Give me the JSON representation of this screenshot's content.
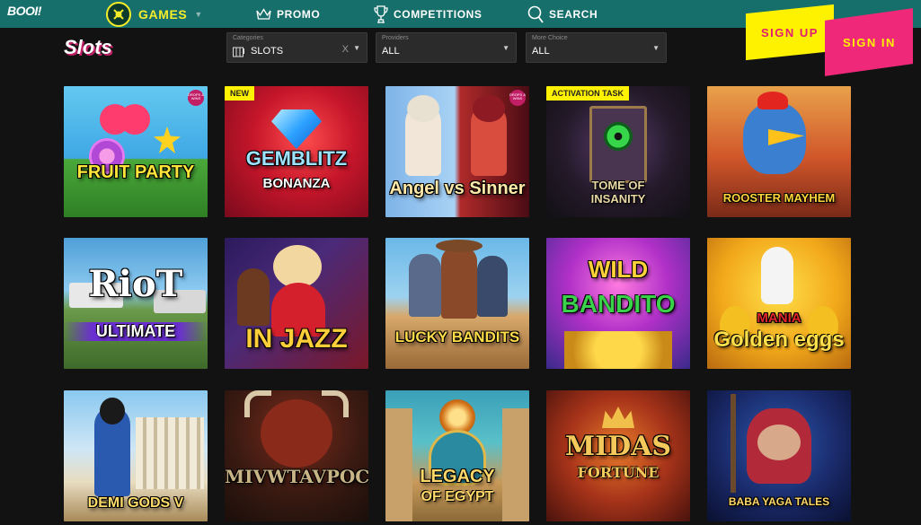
{
  "header": {
    "logo": "BOOI!",
    "nav": [
      {
        "label": "GAMES",
        "icon": "games-icon"
      },
      {
        "label": "PROMO",
        "icon": "crown-icon"
      },
      {
        "label": "COMPETITIONS",
        "icon": "trophy-icon"
      },
      {
        "label": "SEARCH",
        "icon": "search-icon"
      }
    ],
    "signup_label": "SIGN UP",
    "signin_label": "SIGN IN"
  },
  "page": {
    "title": "Slots"
  },
  "filters": {
    "categories": {
      "caption": "Categories",
      "value": "SLOTS",
      "clear": "X"
    },
    "providers": {
      "caption": "Providers",
      "value": "ALL"
    },
    "more_choice": {
      "caption": "More Choice",
      "value": "ALL"
    }
  },
  "games": [
    {
      "title": "FRUIT PARTY",
      "badge": "",
      "drops": "DROPS & WINS"
    },
    {
      "title": "GEMBLITZ",
      "subtitle": "BONANZA",
      "badge": "NEW"
    },
    {
      "title": "Angel vs Sinner",
      "badge": "",
      "drops": "DROPS & WINS"
    },
    {
      "title": "TOME OF",
      "subtitle": "INSANITY",
      "badge": "ACTIVATION TASK"
    },
    {
      "title": "ROOSTER MAYHEM",
      "badge": ""
    },
    {
      "title": "RioT",
      "subtitle": "ULTIMATE",
      "badge": ""
    },
    {
      "title": "IN JAZZ",
      "badge": ""
    },
    {
      "title": "LUCKY BANDITS",
      "badge": ""
    },
    {
      "title": "WILD",
      "subtitle": "BANDITO",
      "badge": ""
    },
    {
      "title": "MANIA",
      "subtitle": "Golden eggs",
      "badge": ""
    },
    {
      "title": "DEMI GODS V",
      "badge": ""
    },
    {
      "title": "MIVWTAVPOC",
      "badge": ""
    },
    {
      "title": "LEGACY",
      "subtitle": "OF EGYPT",
      "badge": ""
    },
    {
      "title": "MIDAS",
      "subtitle": "FORTUNE",
      "badge": ""
    },
    {
      "title": "BABA YAGA TALES",
      "badge": ""
    }
  ],
  "colors": {
    "header_bg": "#176f6b",
    "accent_yellow": "#fff200",
    "accent_pink": "#f0287a",
    "page_bg": "#121212"
  }
}
